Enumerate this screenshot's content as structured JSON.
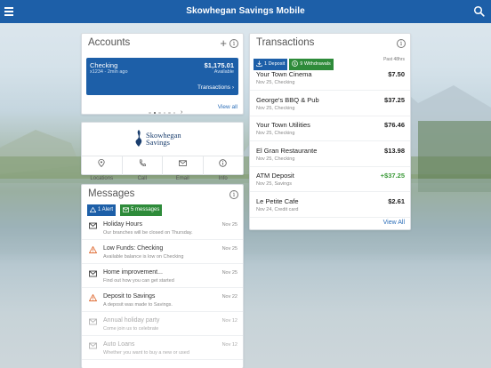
{
  "colors": {
    "brand_blue": "#1d5fa8",
    "deposit_green": "#2e8b3a",
    "alert_orange": "#e0703a",
    "link_blue": "#2a6db8"
  },
  "header": {
    "title": "Skowhegan Savings Mobile",
    "menu_icon": "hamburger-icon",
    "search_icon": "search-icon"
  },
  "accounts": {
    "heading": "Accounts",
    "add_label": "+",
    "info_label": "i",
    "tile": {
      "name": "Checking",
      "sub": "x1234 - 2min ago",
      "balance": "$1,175.01",
      "balance_label": "Available",
      "transactions_link": "Transactions ›"
    },
    "pager_arrow": "›",
    "view_all": "View all"
  },
  "branch": {
    "logo_line1": "Skowhegan",
    "logo_line2": "Savings",
    "actions": [
      {
        "label": "Locations",
        "icon": "location-pin-icon"
      },
      {
        "label": "Call",
        "icon": "phone-icon"
      },
      {
        "label": "Email",
        "icon": "envelope-icon"
      },
      {
        "label": "Info",
        "icon": "info-icon"
      }
    ]
  },
  "messages": {
    "heading": "Messages",
    "info_label": "i",
    "alert_chip": "1 Alert",
    "messages_chip": "5 messages",
    "items": [
      {
        "title": "Holiday Hours",
        "sub": "Our branches will be closed on Thursday.",
        "date": "Nov 25",
        "icon": "envelope-icon",
        "kind": "message"
      },
      {
        "title": "Low Funds: Checking",
        "sub": "Available balance is low on Checking",
        "date": "Nov 25",
        "icon": "warning-icon",
        "kind": "alert"
      },
      {
        "title": "Home improvement...",
        "sub": "Find out how you can get started",
        "date": "Nov 25",
        "icon": "envelope-icon",
        "kind": "message"
      },
      {
        "title": "Deposit to Savings",
        "sub": "A deposit was made to Savings.",
        "date": "Nov 22",
        "icon": "warning-icon",
        "kind": "alert"
      },
      {
        "title": "Annual holiday party",
        "sub": "Come join us to celebrate",
        "date": "Nov 12",
        "icon": "envelope-icon",
        "kind": "read"
      },
      {
        "title": "Auto Loans",
        "sub": "Whether you want to buy a new or used",
        "date": "Nov 12",
        "icon": "envelope-icon",
        "kind": "read"
      }
    ]
  },
  "transactions": {
    "heading": "Transactions",
    "info_label": "i",
    "deposit_chip": "1 Deposit",
    "withdrawal_chip": "9 Withdrawals",
    "range": "Past 48hrs",
    "items": [
      {
        "merchant": "Your Town Cinema",
        "sub": "Nov 25, Checking",
        "amount": "$7.50",
        "positive": false
      },
      {
        "merchant": "George's BBQ & Pub",
        "sub": "Nov 25, Checking",
        "amount": "$37.25",
        "positive": false
      },
      {
        "merchant": "Your Town Utilities",
        "sub": "Nov 25, Checking",
        "amount": "$76.46",
        "positive": false
      },
      {
        "merchant": "El Gran Restaurante",
        "sub": "Nov 25, Checking",
        "amount": "$13.98",
        "positive": false
      },
      {
        "merchant": "ATM Deposit",
        "sub": "Nov 25, Savings",
        "amount": "+$37.25",
        "positive": true
      },
      {
        "merchant": "Le Petite Cafe",
        "sub": "Nov 24, Credit card",
        "amount": "$2.61",
        "positive": false
      }
    ],
    "view_all": "View All"
  }
}
